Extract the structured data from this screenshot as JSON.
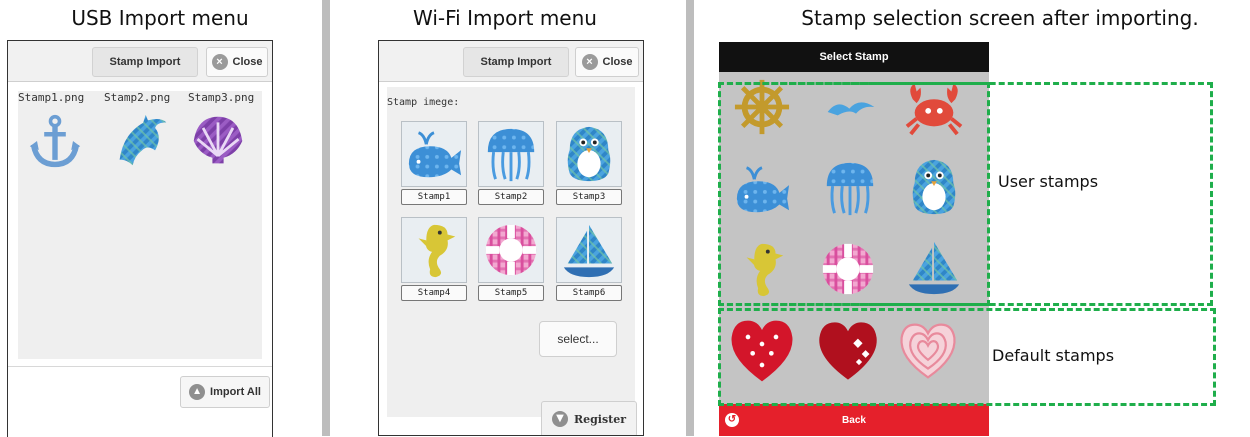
{
  "captions": {
    "usb": "USB Import menu",
    "wifi": "Wi-Fi Import menu",
    "selection": "Stamp selection screen after importing."
  },
  "usb_panel": {
    "tab_label": "Stamp Import",
    "close_label": "Close",
    "files": [
      "Stamp1.png",
      "Stamp2.png",
      "Stamp3.png"
    ],
    "import_all_label": "Import All"
  },
  "wifi_panel": {
    "tab_label": "Stamp Import",
    "close_label": "Close",
    "stamp_image_label": "Stamp imege:",
    "stamps": [
      "Stamp1",
      "Stamp2",
      "Stamp3",
      "Stamp4",
      "Stamp5",
      "Stamp6"
    ],
    "select_label": "select...",
    "register_label": "Register"
  },
  "select_screen": {
    "title": "Select Stamp",
    "back_label": "Back",
    "user_stamps_label": "User stamps",
    "default_stamps_label": "Default stamps"
  },
  "icons": {
    "user_stamps": [
      "helm-icon",
      "seagull-icon",
      "crab-icon",
      "whale-icon",
      "jellyfish-icon",
      "penguin-icon",
      "seahorse-icon",
      "lifebuoy-icon",
      "sailboat-icon"
    ],
    "default_stamps": [
      "heart-icon",
      "sparkle-heart-icon",
      "outline-heart-icon"
    ]
  },
  "colors": {
    "accent_green": "#1fae4b",
    "back_red": "#e5202b",
    "title_bar": "#111111"
  }
}
